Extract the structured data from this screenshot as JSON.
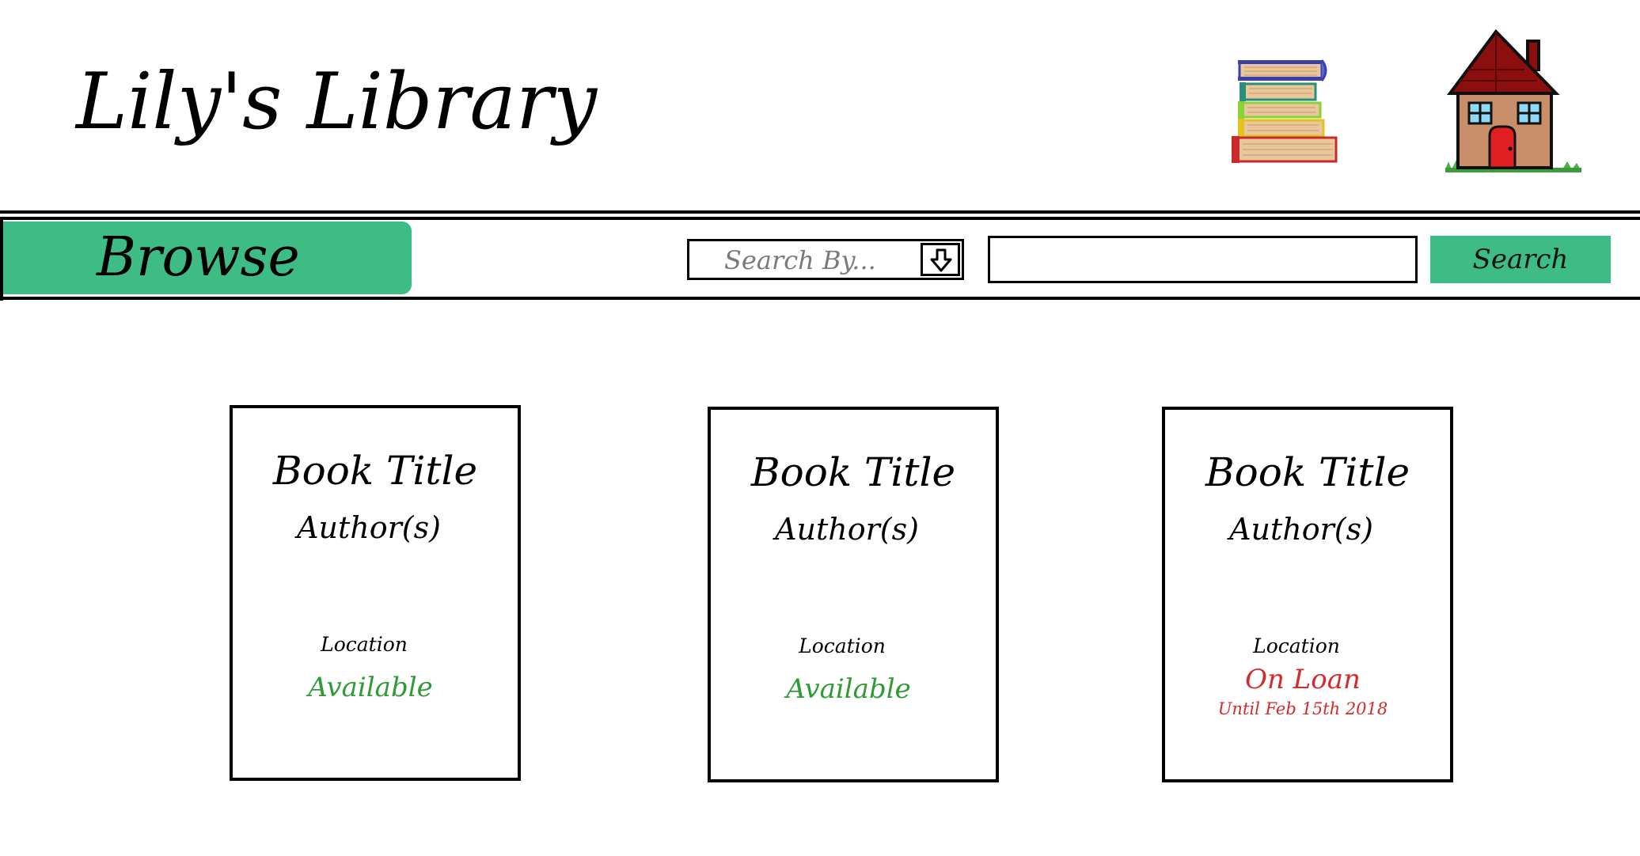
{
  "header": {
    "title": "Lily's Library",
    "books_icon": "book-stack-icon",
    "home_icon": "house-icon"
  },
  "nav": {
    "browse_label": "Browse"
  },
  "search": {
    "search_by_placeholder": "Search By...",
    "dropdown_icon": "arrow-down-icon",
    "query_value": "",
    "button_label": "Search"
  },
  "books": [
    {
      "title": "Book Title",
      "author": "Author(s)",
      "location": "Location",
      "status": "Available",
      "until": ""
    },
    {
      "title": "Book Title",
      "author": "Author(s)",
      "location": "Location",
      "status": "Available",
      "until": ""
    },
    {
      "title": "Book Title",
      "author": "Author(s)",
      "location": "Location",
      "status": "On Loan",
      "until": "Until Feb 15th 2018"
    }
  ],
  "colors": {
    "accent": "#3dbd85",
    "available": "#2e9b35",
    "on_loan": "#d42a2a"
  }
}
